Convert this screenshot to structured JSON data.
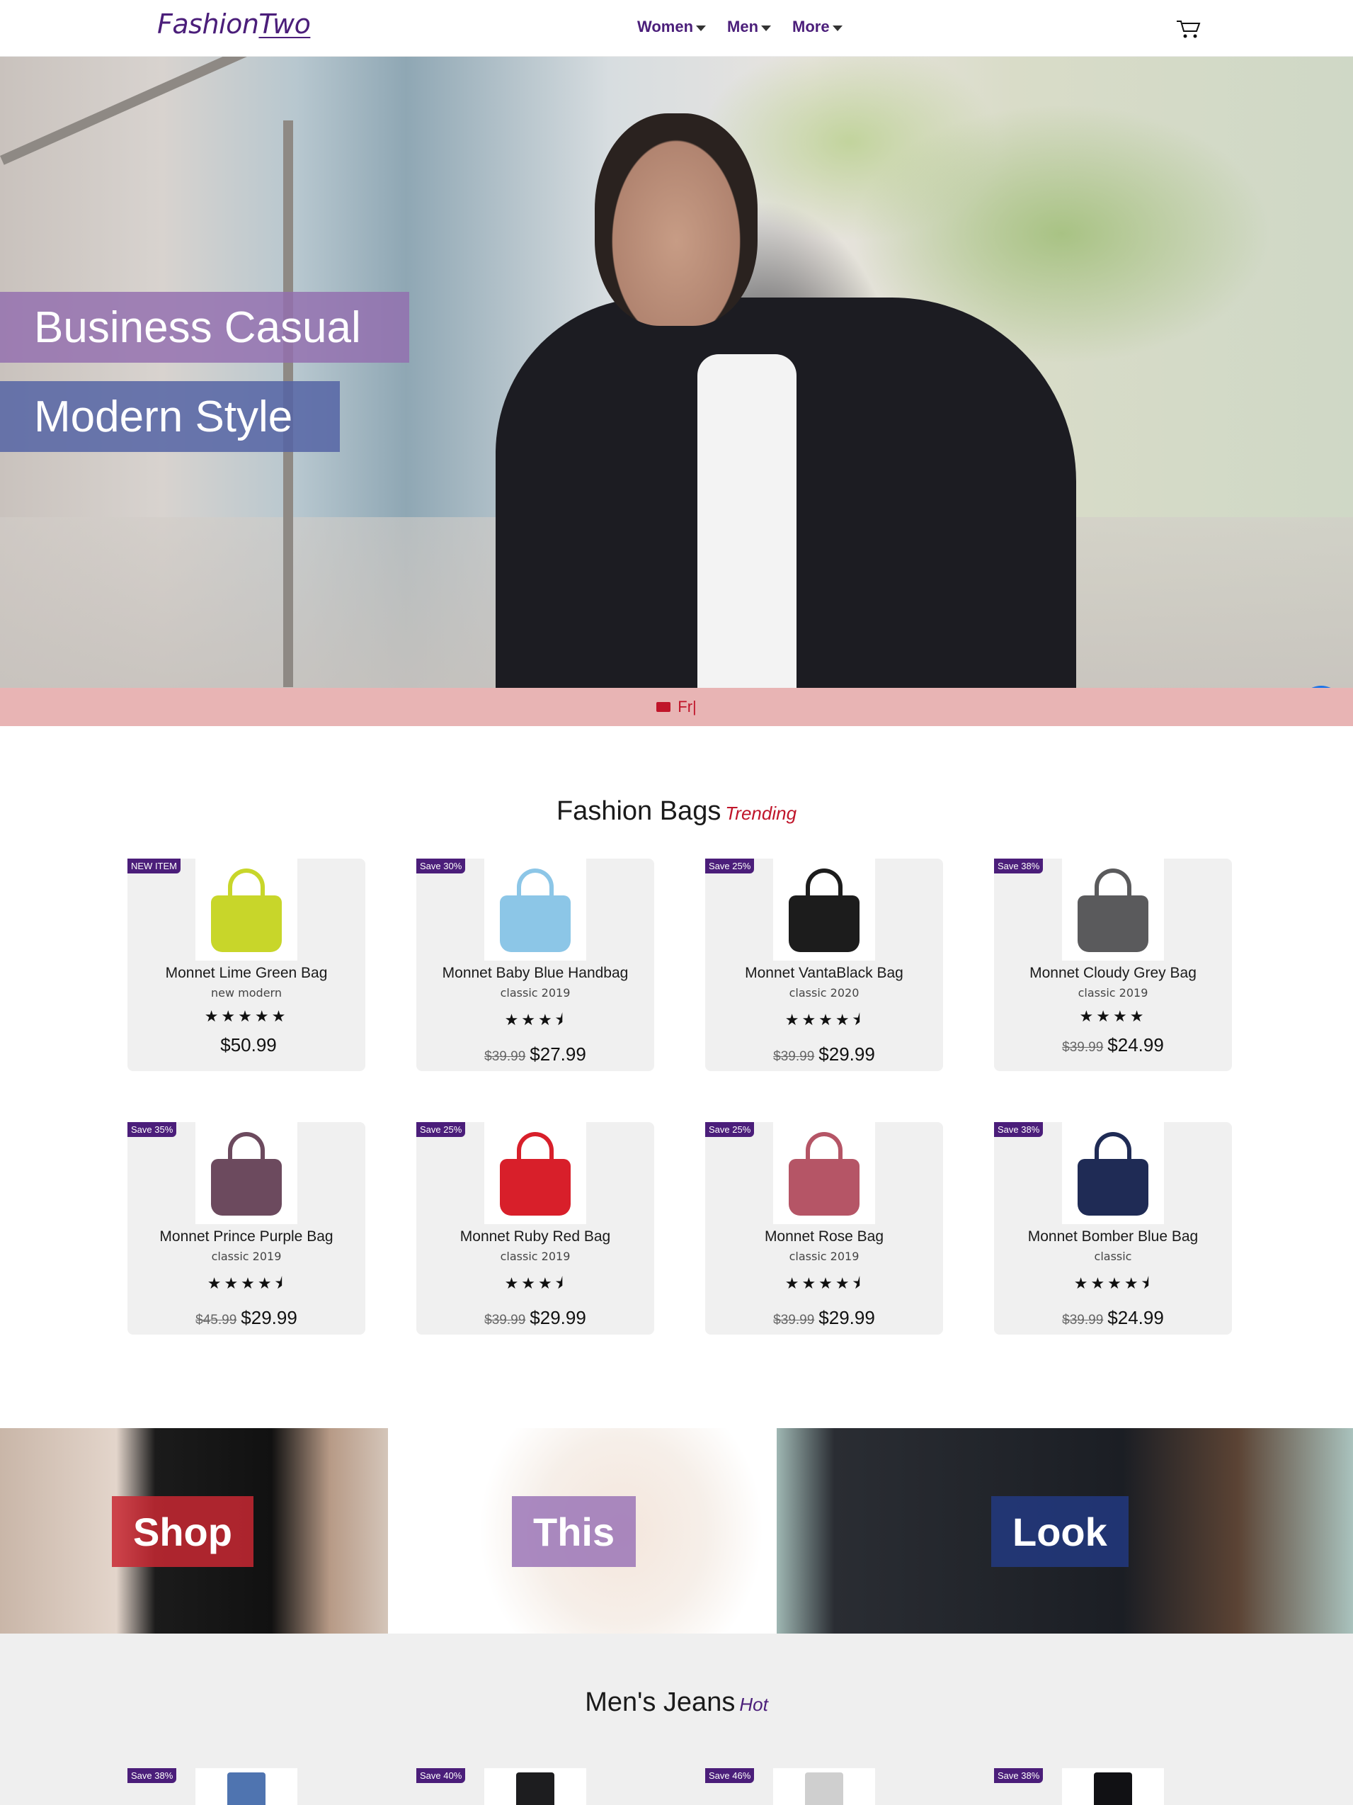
{
  "brand": {
    "logo_a": "Fashion",
    "logo_b": "Two"
  },
  "nav": {
    "items": [
      "Women",
      "Men",
      "More"
    ]
  },
  "hero": {
    "line1": "Business Casual",
    "line2": "Modern Style"
  },
  "shipping_bar": {
    "text": "Fr|"
  },
  "bags": {
    "title": "Fashion Bags",
    "accent": "Trending",
    "items": [
      {
        "badge": "NEW ITEM",
        "name": "Monnet Lime Green Bag",
        "sub": "new modern",
        "stars": "★★★★★",
        "old": "",
        "price": "$50.99",
        "color": "#c8d62a"
      },
      {
        "badge": "Save 30%",
        "name": "Monnet Baby Blue Handbag",
        "sub": "classic 2019",
        "stars": "★★★⯨",
        "old": "$39.99",
        "price": "$27.99",
        "color": "#8cc6e7"
      },
      {
        "badge": "Save 25%",
        "name": "Monnet VantaBlack Bag",
        "sub": "classic 2020",
        "stars": "★★★★⯨",
        "old": "$39.99",
        "price": "$29.99",
        "color": "#1c1c1c"
      },
      {
        "badge": "Save 38%",
        "name": "Monnet Cloudy Grey Bag",
        "sub": "classic 2019",
        "stars": "★★★★",
        "old": "$39.99",
        "price": "$24.99",
        "color": "#5a5a5c"
      },
      {
        "badge": "Save 35%",
        "name": "Monnet Prince Purple Bag",
        "sub": "classic 2019",
        "stars": "★★★★⯨",
        "old": "$45.99",
        "price": "$29.99",
        "color": "#6c4a5e"
      },
      {
        "badge": "Save 25%",
        "name": "Monnet Ruby Red Bag",
        "sub": "classic 2019",
        "stars": "★★★⯨",
        "old": "$39.99",
        "price": "$29.99",
        "color": "#d81f2a"
      },
      {
        "badge": "Save 25%",
        "name": "Monnet Rose Bag",
        "sub": "classic 2019",
        "stars": "★★★★⯨",
        "old": "$39.99",
        "price": "$29.99",
        "color": "#b55566"
      },
      {
        "badge": "Save 38%",
        "name": "Monnet Bomber Blue Bag",
        "sub": "classic",
        "stars": "★★★★⯨",
        "old": "$39.99",
        "price": "$24.99",
        "color": "#1f2b55"
      }
    ]
  },
  "look": {
    "words": [
      "Shop",
      "This",
      "Look"
    ]
  },
  "jeans": {
    "title": "Men's Jeans",
    "accent": "Hot",
    "items": [
      {
        "badge": "Save 38%",
        "color": "#4f74b0"
      },
      {
        "badge": "Save 40%",
        "color": "#1d1d1f"
      },
      {
        "badge": "Save 46%",
        "color": "#cfcfcf"
      },
      {
        "badge": "Save 38%",
        "color": "#111114"
      }
    ]
  },
  "colors": {
    "brand_purple": "#4b1e7a",
    "accent_red": "#c0152a",
    "ship_bar": "#e8b4b4"
  },
  "icons": {
    "cart": "shopping-cart-icon",
    "truck": "truck-icon",
    "chat": "chat-icon"
  }
}
